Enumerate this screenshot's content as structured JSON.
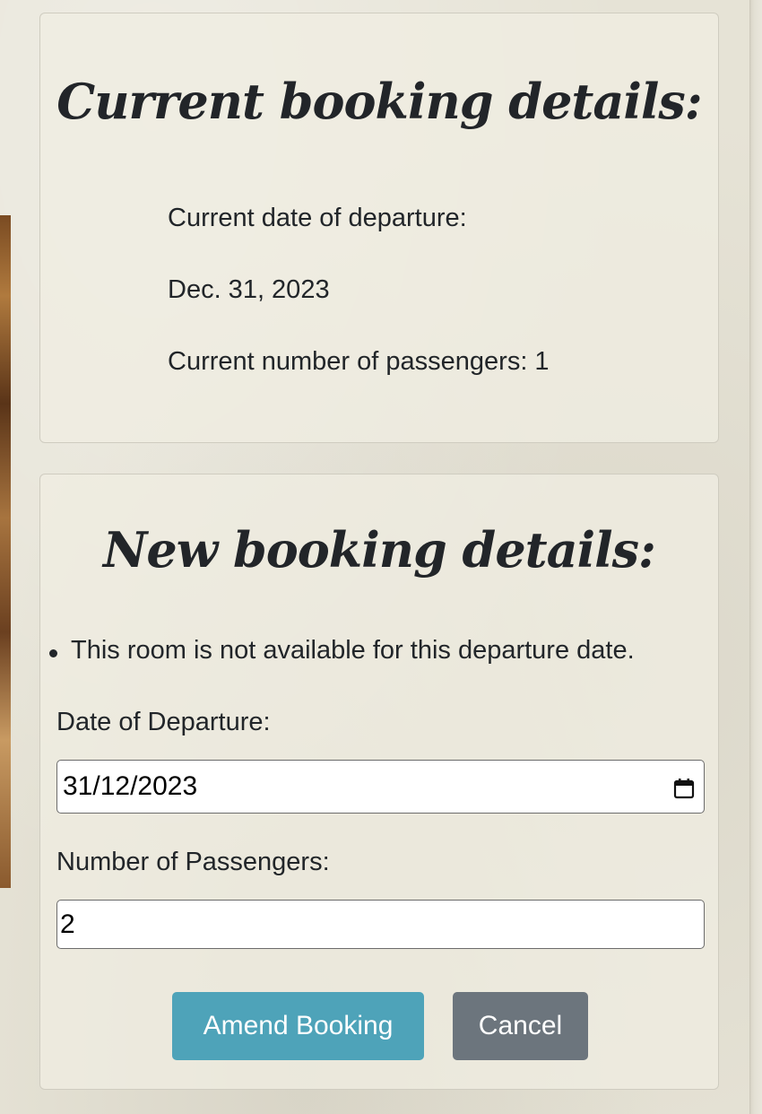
{
  "current": {
    "title": "Current booking details:",
    "departure_label": "Current date of departure:",
    "departure_value": "Dec. 31, 2023",
    "passengers_line": "Current number of passengers: 1"
  },
  "new_booking": {
    "title": "New booking details:",
    "errors": [
      "This room is not available for this departure date."
    ],
    "departure_label": "Date of Departure:",
    "departure_value": "31/12/2023",
    "passengers_label": "Number of Passengers:",
    "passengers_value": "2",
    "amend_label": "Amend Booking",
    "cancel_label": "Cancel"
  },
  "colors": {
    "amend_button": "#4ea3b9",
    "cancel_button": "#6c757d"
  },
  "icons": {
    "date_picker": "calendar-icon"
  }
}
